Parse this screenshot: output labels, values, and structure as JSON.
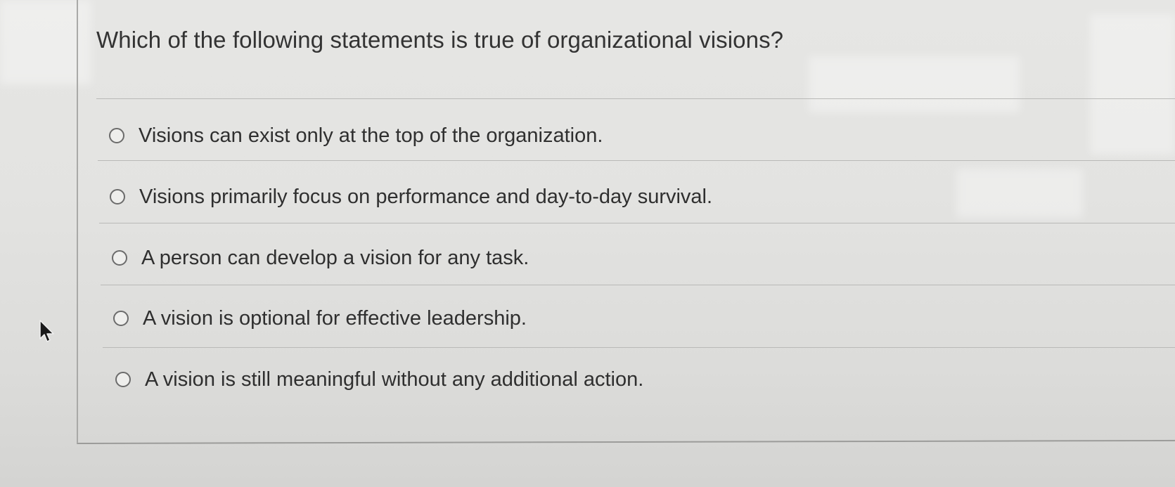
{
  "question": {
    "text": "Which of the following statements is true of organizational visions?"
  },
  "options": [
    {
      "label": "Visions can exist only at the top of the organization.",
      "selected": false
    },
    {
      "label": "Visions primarily focus on performance and day-to-day survival.",
      "selected": false
    },
    {
      "label": "A person can develop a vision for any task.",
      "selected": false
    },
    {
      "label": "A vision is optional for effective leadership.",
      "selected": false
    },
    {
      "label": "A vision is still meaningful without any additional action.",
      "selected": false
    }
  ],
  "cursor": {
    "icon": "mouse-pointer-icon"
  }
}
